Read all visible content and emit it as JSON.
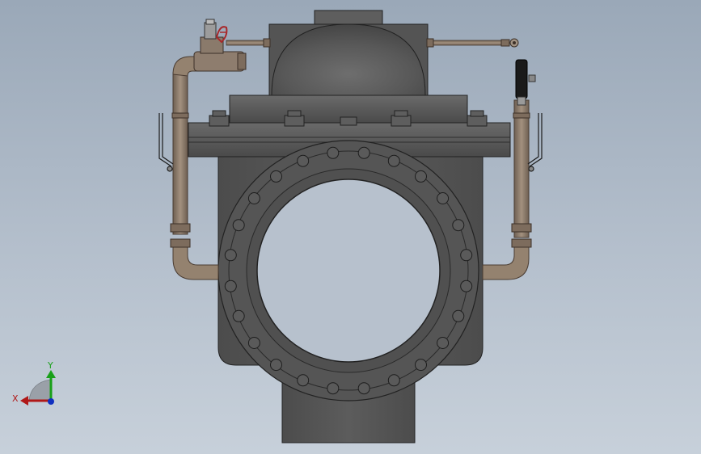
{
  "viewport": {
    "background_top": "#9aa8b8",
    "background_bottom": "#c7d0da"
  },
  "model": {
    "body_color": "#5a5a5a",
    "body_dark": "#4a4a4a",
    "pipe_color": "#8e7d6e",
    "pipe_edge": "#5b4c40",
    "valve_accent": "#a8282a"
  },
  "triad": {
    "x_label": "X",
    "y_label": "Y",
    "x_color": "#b01818",
    "y_color": "#19a019",
    "z_color": "#1030c0"
  }
}
